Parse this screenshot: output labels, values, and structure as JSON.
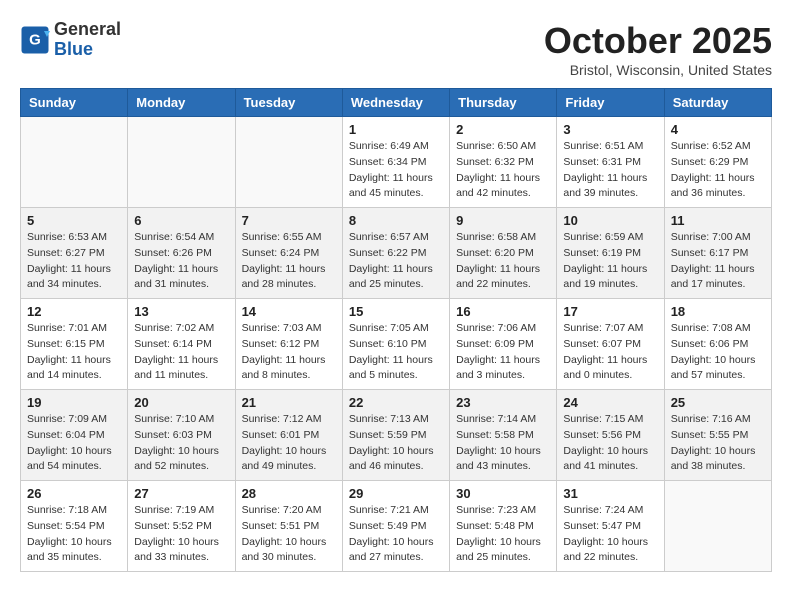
{
  "header": {
    "logo": {
      "general": "General",
      "blue": "Blue"
    },
    "title": "October 2025",
    "location": "Bristol, Wisconsin, United States"
  },
  "weekdays": [
    "Sunday",
    "Monday",
    "Tuesday",
    "Wednesday",
    "Thursday",
    "Friday",
    "Saturday"
  ],
  "weeks": [
    [
      {
        "day": "",
        "info": ""
      },
      {
        "day": "",
        "info": ""
      },
      {
        "day": "",
        "info": ""
      },
      {
        "day": "1",
        "info": "Sunrise: 6:49 AM\nSunset: 6:34 PM\nDaylight: 11 hours\nand 45 minutes."
      },
      {
        "day": "2",
        "info": "Sunrise: 6:50 AM\nSunset: 6:32 PM\nDaylight: 11 hours\nand 42 minutes."
      },
      {
        "day": "3",
        "info": "Sunrise: 6:51 AM\nSunset: 6:31 PM\nDaylight: 11 hours\nand 39 minutes."
      },
      {
        "day": "4",
        "info": "Sunrise: 6:52 AM\nSunset: 6:29 PM\nDaylight: 11 hours\nand 36 minutes."
      }
    ],
    [
      {
        "day": "5",
        "info": "Sunrise: 6:53 AM\nSunset: 6:27 PM\nDaylight: 11 hours\nand 34 minutes."
      },
      {
        "day": "6",
        "info": "Sunrise: 6:54 AM\nSunset: 6:26 PM\nDaylight: 11 hours\nand 31 minutes."
      },
      {
        "day": "7",
        "info": "Sunrise: 6:55 AM\nSunset: 6:24 PM\nDaylight: 11 hours\nand 28 minutes."
      },
      {
        "day": "8",
        "info": "Sunrise: 6:57 AM\nSunset: 6:22 PM\nDaylight: 11 hours\nand 25 minutes."
      },
      {
        "day": "9",
        "info": "Sunrise: 6:58 AM\nSunset: 6:20 PM\nDaylight: 11 hours\nand 22 minutes."
      },
      {
        "day": "10",
        "info": "Sunrise: 6:59 AM\nSunset: 6:19 PM\nDaylight: 11 hours\nand 19 minutes."
      },
      {
        "day": "11",
        "info": "Sunrise: 7:00 AM\nSunset: 6:17 PM\nDaylight: 11 hours\nand 17 minutes."
      }
    ],
    [
      {
        "day": "12",
        "info": "Sunrise: 7:01 AM\nSunset: 6:15 PM\nDaylight: 11 hours\nand 14 minutes."
      },
      {
        "day": "13",
        "info": "Sunrise: 7:02 AM\nSunset: 6:14 PM\nDaylight: 11 hours\nand 11 minutes."
      },
      {
        "day": "14",
        "info": "Sunrise: 7:03 AM\nSunset: 6:12 PM\nDaylight: 11 hours\nand 8 minutes."
      },
      {
        "day": "15",
        "info": "Sunrise: 7:05 AM\nSunset: 6:10 PM\nDaylight: 11 hours\nand 5 minutes."
      },
      {
        "day": "16",
        "info": "Sunrise: 7:06 AM\nSunset: 6:09 PM\nDaylight: 11 hours\nand 3 minutes."
      },
      {
        "day": "17",
        "info": "Sunrise: 7:07 AM\nSunset: 6:07 PM\nDaylight: 11 hours\nand 0 minutes."
      },
      {
        "day": "18",
        "info": "Sunrise: 7:08 AM\nSunset: 6:06 PM\nDaylight: 10 hours\nand 57 minutes."
      }
    ],
    [
      {
        "day": "19",
        "info": "Sunrise: 7:09 AM\nSunset: 6:04 PM\nDaylight: 10 hours\nand 54 minutes."
      },
      {
        "day": "20",
        "info": "Sunrise: 7:10 AM\nSunset: 6:03 PM\nDaylight: 10 hours\nand 52 minutes."
      },
      {
        "day": "21",
        "info": "Sunrise: 7:12 AM\nSunset: 6:01 PM\nDaylight: 10 hours\nand 49 minutes."
      },
      {
        "day": "22",
        "info": "Sunrise: 7:13 AM\nSunset: 5:59 PM\nDaylight: 10 hours\nand 46 minutes."
      },
      {
        "day": "23",
        "info": "Sunrise: 7:14 AM\nSunset: 5:58 PM\nDaylight: 10 hours\nand 43 minutes."
      },
      {
        "day": "24",
        "info": "Sunrise: 7:15 AM\nSunset: 5:56 PM\nDaylight: 10 hours\nand 41 minutes."
      },
      {
        "day": "25",
        "info": "Sunrise: 7:16 AM\nSunset: 5:55 PM\nDaylight: 10 hours\nand 38 minutes."
      }
    ],
    [
      {
        "day": "26",
        "info": "Sunrise: 7:18 AM\nSunset: 5:54 PM\nDaylight: 10 hours\nand 35 minutes."
      },
      {
        "day": "27",
        "info": "Sunrise: 7:19 AM\nSunset: 5:52 PM\nDaylight: 10 hours\nand 33 minutes."
      },
      {
        "day": "28",
        "info": "Sunrise: 7:20 AM\nSunset: 5:51 PM\nDaylight: 10 hours\nand 30 minutes."
      },
      {
        "day": "29",
        "info": "Sunrise: 7:21 AM\nSunset: 5:49 PM\nDaylight: 10 hours\nand 27 minutes."
      },
      {
        "day": "30",
        "info": "Sunrise: 7:23 AM\nSunset: 5:48 PM\nDaylight: 10 hours\nand 25 minutes."
      },
      {
        "day": "31",
        "info": "Sunrise: 7:24 AM\nSunset: 5:47 PM\nDaylight: 10 hours\nand 22 minutes."
      },
      {
        "day": "",
        "info": ""
      }
    ]
  ]
}
